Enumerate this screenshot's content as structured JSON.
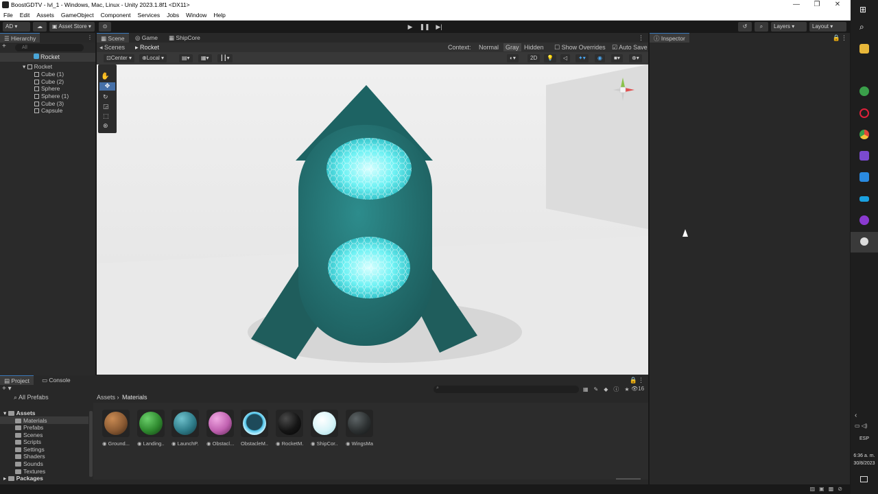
{
  "window": {
    "title": "BoostGDTV - lvl_1 - Windows, Mac, Linux - Unity 2023.1.8f1 <DX11>"
  },
  "menu": [
    "File",
    "Edit",
    "Assets",
    "GameObject",
    "Component",
    "Services",
    "Jobs",
    "Window",
    "Help"
  ],
  "toolbar": {
    "account": "AD",
    "asset_store": "Asset Store",
    "layers": "Layers",
    "layout": "Layout"
  },
  "hierarchy": {
    "tab": "Hierarchy",
    "search_placeholder": "All",
    "scene_root": "Rocket",
    "items": [
      {
        "label": "Rocket"
      },
      {
        "label": "Cube (1)"
      },
      {
        "label": "Cube (2)"
      },
      {
        "label": "Sphere"
      },
      {
        "label": "Sphere (1)"
      },
      {
        "label": "Cube (3)"
      },
      {
        "label": "Capsule"
      }
    ]
  },
  "scene": {
    "tabs": [
      "Scene",
      "Game",
      "ShipCore"
    ],
    "breadcrumb": [
      "Scenes",
      "Rocket"
    ],
    "context_label": "Context:",
    "context_options": [
      "Normal",
      "Gray",
      "Hidden"
    ],
    "context_selected": "Gray",
    "show_overrides": "Show Overrides",
    "auto_save": "Auto Save",
    "pivot": "Center",
    "space": "Local",
    "mode_2d": "2D"
  },
  "inspector": {
    "tab": "Inspector"
  },
  "project": {
    "tabs": [
      "Project",
      "Console"
    ],
    "all_prefabs": "All Prefabs",
    "breadcrumb": [
      "Assets",
      "Materials"
    ],
    "search_count": "16",
    "tree": [
      {
        "label": "Assets",
        "root": true
      },
      {
        "label": "Materials"
      },
      {
        "label": "Prefabs"
      },
      {
        "label": "Scenes"
      },
      {
        "label": "Scripts"
      },
      {
        "label": "Settings"
      },
      {
        "label": "Shaders"
      },
      {
        "label": "Sounds"
      },
      {
        "label": "Textures"
      },
      {
        "label": "Packages",
        "root": true
      }
    ],
    "materials": [
      {
        "label": "Ground...",
        "color": "#8a5a33"
      },
      {
        "label": "Landing...",
        "color": "#2f8a2f"
      },
      {
        "label": "LaunchP...",
        "color": "#2f7d8a"
      },
      {
        "label": "Obstacl...",
        "color": "#c061b0"
      },
      {
        "label": "ObstacleM...",
        "color": "#4fc3e8"
      },
      {
        "label": "RocketM...",
        "color": "#151515"
      },
      {
        "label": "ShipCor...",
        "color": "#d8f4f8"
      },
      {
        "label": "WingsMat",
        "color": "#2d3132"
      }
    ]
  },
  "taskbar": {
    "lang": "ESP",
    "time": "6:36 a. m.",
    "date": "30/8/2023"
  }
}
